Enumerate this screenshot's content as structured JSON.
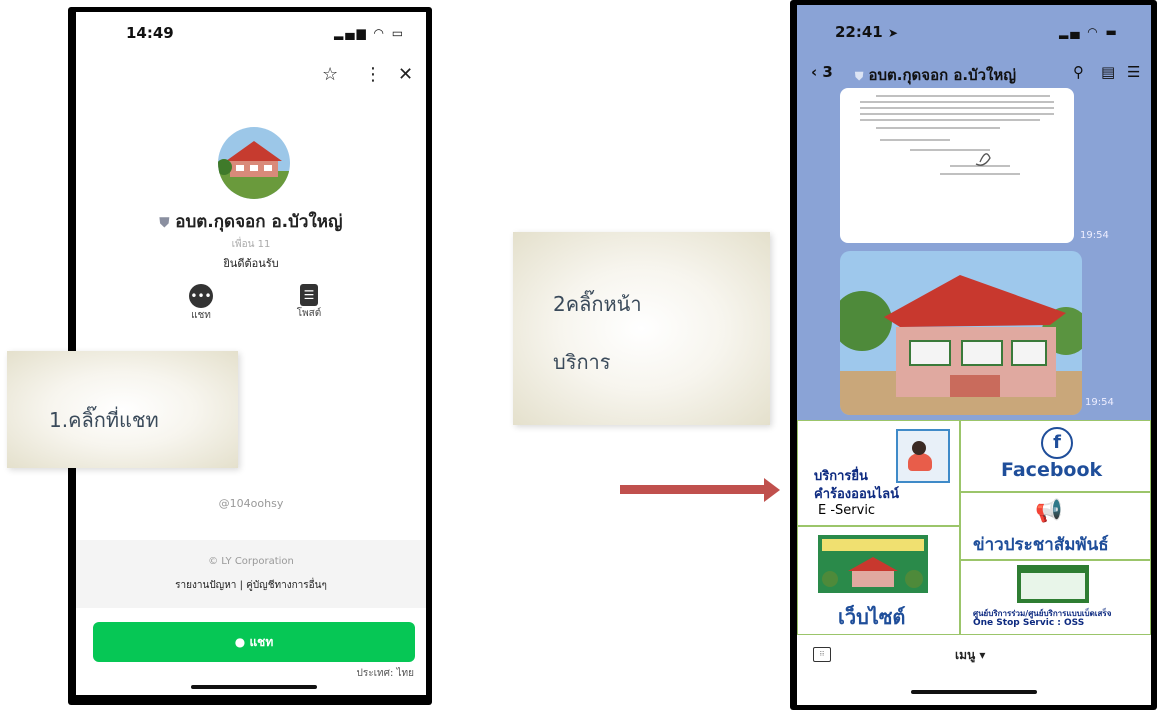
{
  "left_phone": {
    "time": "14:49",
    "status_icons": "signal wifi battery",
    "profile_name": "อบต.กุดจอก อ.บัวใหญ่",
    "friends": "เพื่อน 11",
    "greeting": "ยินดีต้อนรับ",
    "actions": [
      {
        "icon": "chat-bubble-icon",
        "label": "แชท"
      },
      {
        "icon": "post-icon",
        "label": "โพสต์"
      }
    ],
    "line_id": "@104oohsy",
    "corp": "© LY Corporation",
    "links": "รายงานปัญหา | คู่บัญชีทางการอื่นๆ",
    "chat_button": "แชท",
    "country": "ประเทศ: ไทย"
  },
  "callouts": {
    "step1": "1.คลิ๊กที่แชท",
    "step2_line1": "2คลิ๊กหน้า",
    "step2_line2": "บริการ"
  },
  "right_phone": {
    "time": "22:41",
    "back_label": "3",
    "chat_title": "อบต.กุดจอก อ.บัวใหญ่",
    "msg_time_1": "19:54",
    "msg_time_2": "19:54",
    "menu": {
      "eservice_line1": "บริการยื่น",
      "eservice_line2": "คำร้องออนไลน์",
      "eservice_line3": "E -Servic",
      "facebook": "Facebook",
      "news": "ข่าวประชาสัมพันธ์",
      "website": "เว็บไซต์",
      "oss_line1": "ศูนย์บริการร่วม/ศูนย์บริการแบบเบ็ดเสร็จ",
      "oss_line2": "One Stop Servic : OSS"
    },
    "bottom_menu": "เมนู ▾"
  },
  "colors": {
    "line_green": "#06c755",
    "arrow": "#c0504d",
    "chat_bg": "#8aa3d6",
    "facebook_blue": "#1f4e9a"
  }
}
